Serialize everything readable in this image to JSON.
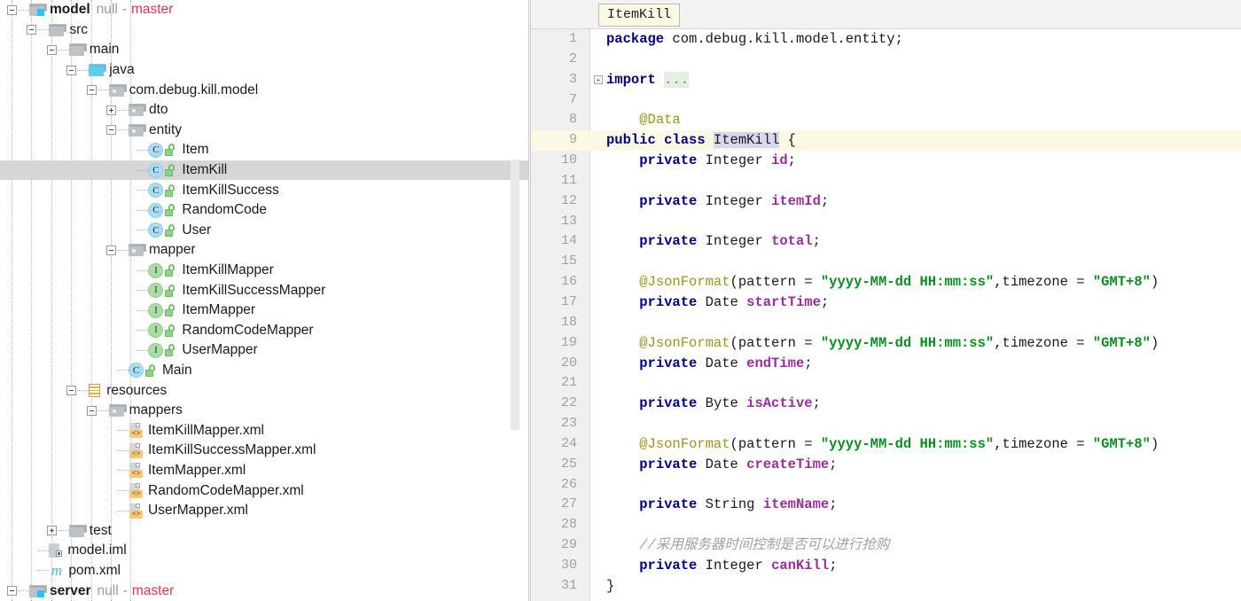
{
  "tree": {
    "selected_label": "ItemKill",
    "items": [
      {
        "depth": 0,
        "toggle": "minus",
        "icon": "module-folder-icon",
        "label": "model",
        "bold": true,
        "meta": {
          "null": "null",
          "dash": "-",
          "branch": "master"
        }
      },
      {
        "depth": 1,
        "toggle": "minus",
        "icon": "folder-icon",
        "label": "src"
      },
      {
        "depth": 2,
        "toggle": "minus",
        "icon": "folder-icon",
        "label": "main"
      },
      {
        "depth": 3,
        "toggle": "minus",
        "icon": "source-root-folder-icon",
        "label": "java"
      },
      {
        "depth": 4,
        "toggle": "minus",
        "icon": "package-folder-icon",
        "label": "com.debug.kill.model"
      },
      {
        "depth": 5,
        "toggle": "plus",
        "icon": "package-folder-icon",
        "label": "dto"
      },
      {
        "depth": 5,
        "toggle": "minus",
        "icon": "package-folder-icon",
        "label": "entity"
      },
      {
        "depth": 6,
        "toggle": "none",
        "icon": "java-class-icon",
        "badge": "C",
        "lock": true,
        "label": "Item"
      },
      {
        "depth": 6,
        "toggle": "none",
        "icon": "java-class-icon",
        "badge": "C",
        "lock": true,
        "label": "ItemKill",
        "selected": true
      },
      {
        "depth": 6,
        "toggle": "none",
        "icon": "java-class-icon",
        "badge": "C",
        "lock": true,
        "label": "ItemKillSuccess"
      },
      {
        "depth": 6,
        "toggle": "none",
        "icon": "java-class-icon",
        "badge": "C",
        "lock": true,
        "label": "RandomCode"
      },
      {
        "depth": 6,
        "toggle": "none",
        "icon": "java-class-icon",
        "badge": "C",
        "lock": true,
        "label": "User"
      },
      {
        "depth": 5,
        "toggle": "minus",
        "icon": "package-folder-icon",
        "label": "mapper"
      },
      {
        "depth": 6,
        "toggle": "none",
        "icon": "java-interface-icon",
        "badge": "I",
        "lock": true,
        "label": "ItemKillMapper"
      },
      {
        "depth": 6,
        "toggle": "none",
        "icon": "java-interface-icon",
        "badge": "I",
        "lock": true,
        "label": "ItemKillSuccessMapper"
      },
      {
        "depth": 6,
        "toggle": "none",
        "icon": "java-interface-icon",
        "badge": "I",
        "lock": true,
        "label": "ItemMapper"
      },
      {
        "depth": 6,
        "toggle": "none",
        "icon": "java-interface-icon",
        "badge": "I",
        "lock": true,
        "label": "RandomCodeMapper"
      },
      {
        "depth": 6,
        "toggle": "none",
        "icon": "java-interface-icon",
        "badge": "I",
        "lock": true,
        "label": "UserMapper"
      },
      {
        "depth": 5,
        "toggle": "none",
        "icon": "java-class-icon",
        "badge": "C",
        "lock": true,
        "label": "Main"
      },
      {
        "depth": 3,
        "toggle": "minus",
        "icon": "resources-folder-icon",
        "label": "resources"
      },
      {
        "depth": 4,
        "toggle": "minus",
        "icon": "package-folder-icon",
        "label": "mappers"
      },
      {
        "depth": 5,
        "toggle": "none",
        "icon": "xml-file-icon",
        "label": "ItemKillMapper.xml"
      },
      {
        "depth": 5,
        "toggle": "none",
        "icon": "xml-file-icon",
        "label": "ItemKillSuccessMapper.xml"
      },
      {
        "depth": 5,
        "toggle": "none",
        "icon": "xml-file-icon",
        "label": "ItemMapper.xml"
      },
      {
        "depth": 5,
        "toggle": "none",
        "icon": "xml-file-icon",
        "label": "RandomCodeMapper.xml"
      },
      {
        "depth": 5,
        "toggle": "none",
        "icon": "xml-file-icon",
        "label": "UserMapper.xml"
      },
      {
        "depth": 2,
        "toggle": "plus",
        "icon": "folder-icon",
        "label": "test"
      },
      {
        "depth": 1,
        "toggle": "none",
        "icon": "iml-file-icon",
        "label": "model.iml"
      },
      {
        "depth": 1,
        "toggle": "none",
        "icon": "maven-file-icon",
        "label": "pom.xml"
      },
      {
        "depth": 0,
        "toggle": "minus",
        "icon": "module-folder-icon",
        "label": "server",
        "bold": true,
        "meta": {
          "null": "null",
          "dash": "-",
          "branch": "master"
        }
      }
    ]
  },
  "editor": {
    "tab_label": "ItemKill",
    "fold_marker": "+",
    "lines": [
      {
        "num": "1",
        "tokens": [
          {
            "t": "package ",
            "c": "kw"
          },
          {
            "t": "com.debug.kill.model.entity;",
            "c": "pl"
          }
        ]
      },
      {
        "num": "2",
        "tokens": []
      },
      {
        "num": "3",
        "fold": true,
        "tokens": [
          {
            "t": "import ",
            "c": "kw"
          },
          {
            "t": "...",
            "c": "ellip"
          }
        ]
      },
      {
        "num": "7",
        "tokens": []
      },
      {
        "num": "8",
        "tokens": [
          {
            "t": "    ",
            "c": "pl"
          },
          {
            "t": "@Data",
            "c": "ann"
          }
        ],
        "indent0": true
      },
      {
        "num": "9",
        "current": true,
        "tokens": [
          {
            "t": "public class ",
            "c": "kw"
          },
          {
            "t": "ItemKill",
            "c": "sel",
            "caret": true
          },
          {
            "t": " {",
            "c": "pl"
          }
        ]
      },
      {
        "num": "10",
        "tokens": [
          {
            "t": "    ",
            "c": "pl"
          },
          {
            "t": "private ",
            "c": "kw"
          },
          {
            "t": "Integer ",
            "c": "pl"
          },
          {
            "t": "id",
            "c": "fld"
          },
          {
            "t": ";",
            "c": "pl"
          }
        ]
      },
      {
        "num": "11",
        "tokens": []
      },
      {
        "num": "12",
        "tokens": [
          {
            "t": "    ",
            "c": "pl"
          },
          {
            "t": "private ",
            "c": "kw"
          },
          {
            "t": "Integer ",
            "c": "pl"
          },
          {
            "t": "itemId",
            "c": "fld"
          },
          {
            "t": ";",
            "c": "pl"
          }
        ]
      },
      {
        "num": "13",
        "tokens": []
      },
      {
        "num": "14",
        "tokens": [
          {
            "t": "    ",
            "c": "pl"
          },
          {
            "t": "private ",
            "c": "kw"
          },
          {
            "t": "Integer ",
            "c": "pl"
          },
          {
            "t": "total",
            "c": "fld"
          },
          {
            "t": ";",
            "c": "pl"
          }
        ]
      },
      {
        "num": "15",
        "tokens": []
      },
      {
        "num": "16",
        "tokens": [
          {
            "t": "    ",
            "c": "pl"
          },
          {
            "t": "@JsonFormat",
            "c": "ann"
          },
          {
            "t": "(pattern = ",
            "c": "pl"
          },
          {
            "t": "\"yyyy-MM-dd HH:mm:ss\"",
            "c": "str"
          },
          {
            "t": ",timezone = ",
            "c": "pl"
          },
          {
            "t": "\"GMT+8\"",
            "c": "str"
          },
          {
            "t": ")",
            "c": "pl"
          }
        ]
      },
      {
        "num": "17",
        "tokens": [
          {
            "t": "    ",
            "c": "pl"
          },
          {
            "t": "private ",
            "c": "kw"
          },
          {
            "t": "Date ",
            "c": "pl"
          },
          {
            "t": "startTime",
            "c": "fld"
          },
          {
            "t": ";",
            "c": "pl"
          }
        ]
      },
      {
        "num": "18",
        "tokens": []
      },
      {
        "num": "19",
        "tokens": [
          {
            "t": "    ",
            "c": "pl"
          },
          {
            "t": "@JsonFormat",
            "c": "ann"
          },
          {
            "t": "(pattern = ",
            "c": "pl"
          },
          {
            "t": "\"yyyy-MM-dd HH:mm:ss\"",
            "c": "str"
          },
          {
            "t": ",timezone = ",
            "c": "pl"
          },
          {
            "t": "\"GMT+8\"",
            "c": "str"
          },
          {
            "t": ")",
            "c": "pl"
          }
        ]
      },
      {
        "num": "20",
        "tokens": [
          {
            "t": "    ",
            "c": "pl"
          },
          {
            "t": "private ",
            "c": "kw"
          },
          {
            "t": "Date ",
            "c": "pl"
          },
          {
            "t": "endTime",
            "c": "fld"
          },
          {
            "t": ";",
            "c": "pl"
          }
        ]
      },
      {
        "num": "21",
        "tokens": []
      },
      {
        "num": "22",
        "tokens": [
          {
            "t": "    ",
            "c": "pl"
          },
          {
            "t": "private ",
            "c": "kw"
          },
          {
            "t": "Byte ",
            "c": "pl"
          },
          {
            "t": "isActive",
            "c": "fld"
          },
          {
            "t": ";",
            "c": "pl"
          }
        ]
      },
      {
        "num": "23",
        "tokens": []
      },
      {
        "num": "24",
        "tokens": [
          {
            "t": "    ",
            "c": "pl"
          },
          {
            "t": "@JsonFormat",
            "c": "ann"
          },
          {
            "t": "(pattern = ",
            "c": "pl"
          },
          {
            "t": "\"yyyy-MM-dd HH:mm:ss\"",
            "c": "str"
          },
          {
            "t": ",timezone = ",
            "c": "pl"
          },
          {
            "t": "\"GMT+8\"",
            "c": "str"
          },
          {
            "t": ")",
            "c": "pl"
          }
        ]
      },
      {
        "num": "25",
        "tokens": [
          {
            "t": "    ",
            "c": "pl"
          },
          {
            "t": "private ",
            "c": "kw"
          },
          {
            "t": "Date ",
            "c": "pl"
          },
          {
            "t": "createTime",
            "c": "fld"
          },
          {
            "t": ";",
            "c": "pl"
          }
        ]
      },
      {
        "num": "26",
        "tokens": []
      },
      {
        "num": "27",
        "tokens": [
          {
            "t": "    ",
            "c": "pl"
          },
          {
            "t": "private ",
            "c": "kw"
          },
          {
            "t": "String ",
            "c": "pl"
          },
          {
            "t": "itemName",
            "c": "fld"
          },
          {
            "t": ";",
            "c": "pl"
          }
        ]
      },
      {
        "num": "28",
        "tokens": []
      },
      {
        "num": "29",
        "tokens": [
          {
            "t": "    ",
            "c": "pl"
          },
          {
            "t": "//采用服务器时间控制是否可以进行抢购",
            "c": "cmt"
          }
        ]
      },
      {
        "num": "30",
        "tokens": [
          {
            "t": "    ",
            "c": "pl"
          },
          {
            "t": "private ",
            "c": "kw"
          },
          {
            "t": "Integer ",
            "c": "pl"
          },
          {
            "t": "canKill",
            "c": "fld"
          },
          {
            "t": ";",
            "c": "pl"
          }
        ]
      },
      {
        "num": "31",
        "tokens": [
          {
            "t": "}",
            "c": "pl"
          }
        ]
      }
    ]
  },
  "colors": {
    "keyword": "#000082",
    "annotation": "#9e9220",
    "field": "#9b2d9b",
    "string": "#0b8b22",
    "comment": "#a0a0a0",
    "branch": "#e8334a",
    "selection": "#d8d7f0",
    "current_line": "#fdf8e4",
    "tree_selection": "#d6d6d6"
  }
}
